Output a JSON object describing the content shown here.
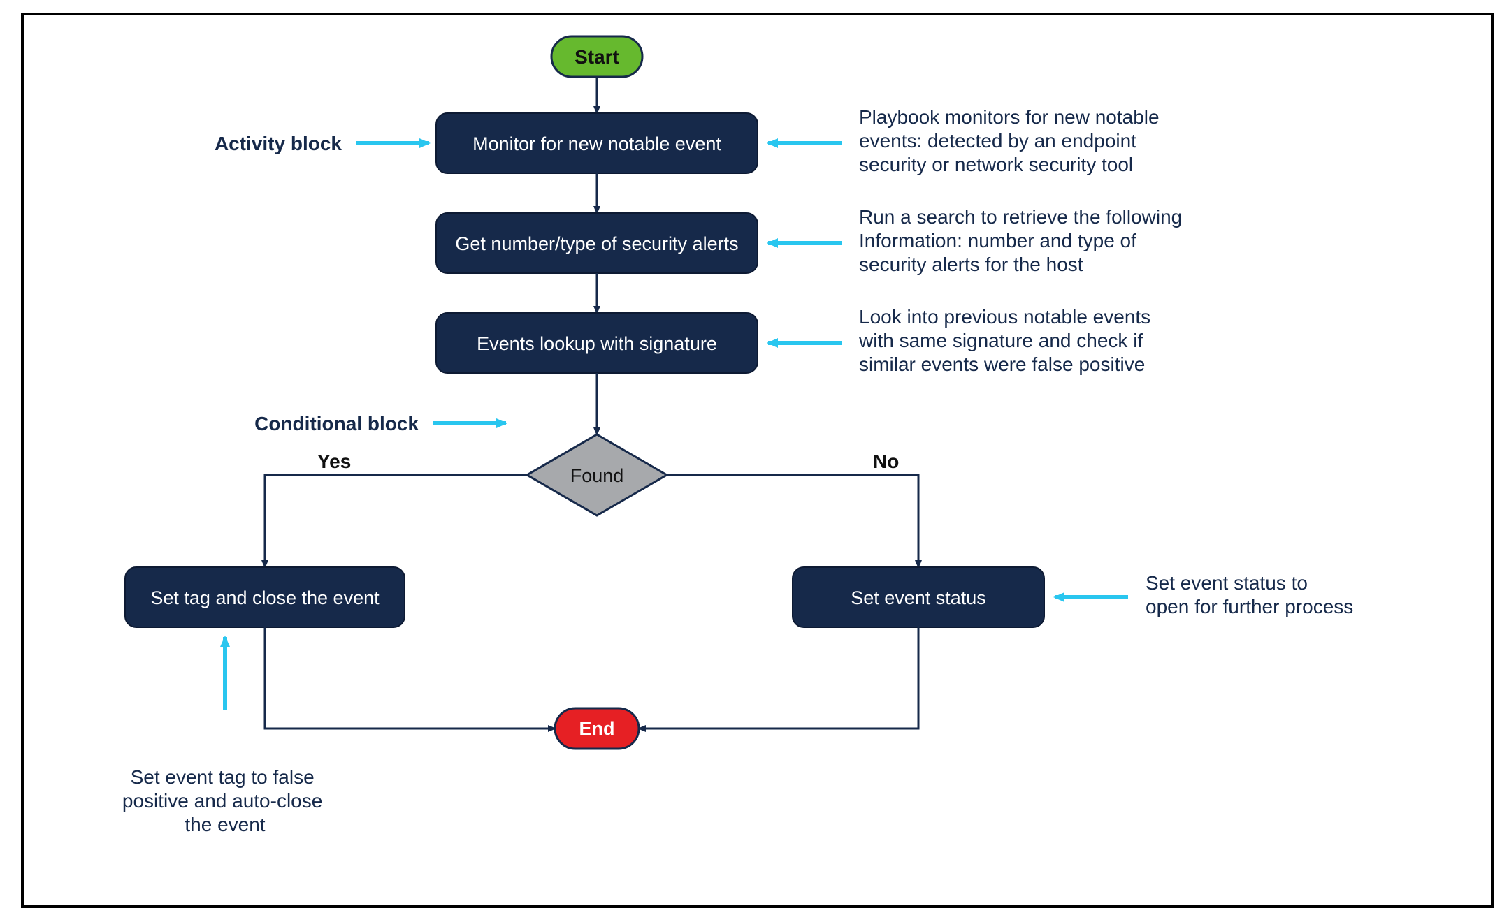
{
  "colors": {
    "navy": "#16294a",
    "navyStroke": "#0d1a33",
    "green": "#66b92e",
    "greenStroke": "#16294a",
    "red": "#e62024",
    "gray": "#a7a9ac",
    "cyan": "#29c6ef",
    "textDark": "#16294a",
    "textLight": "#ffffff",
    "textBlack": "#111"
  },
  "nodes": {
    "start": "Start",
    "monitor": "Monitor for new notable event",
    "alerts": "Get number/type of security alerts",
    "lookup": "Events lookup with signature",
    "found": "Found",
    "yes": "Yes",
    "no": "No",
    "tagClose": "Set tag and close the event",
    "setStatus": "Set event status",
    "end": "End"
  },
  "annotations": {
    "activity": "Activity block",
    "conditional": "Conditional block",
    "monitorDesc": "Playbook monitors for new notable events: detected by an endpoint security or network security tool",
    "alertsDesc": "Run a search to retrieve the following Information: number and type of security alerts for the host",
    "lookupDesc": "Look into previous notable events with same signature and check if similar events were false positive",
    "statusDesc": "Set event status to open for further process",
    "tagDesc": "Set event tag to false positive and auto-close the event"
  }
}
